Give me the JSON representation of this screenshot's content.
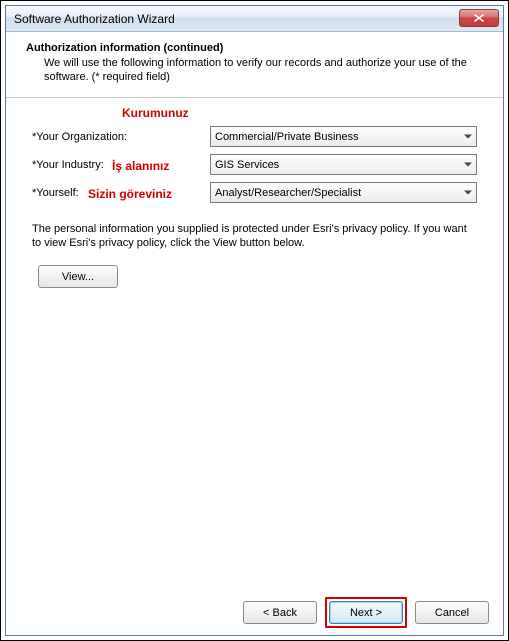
{
  "window": {
    "title": "Software Authorization Wizard"
  },
  "header": {
    "title": "Authorization information (continued)",
    "description": "We will use the following information to verify our records and authorize your use of the software. (* required field)"
  },
  "form": {
    "org_label": "*Your Organization:",
    "org_value": "Commercial/Private Business",
    "industry_label": "*Your Industry:",
    "industry_value": "GIS Services",
    "yourself_label": "*Yourself:",
    "yourself_value": "Analyst/Researcher/Specialist"
  },
  "privacy": {
    "text": "The personal information you supplied is protected under Esri's privacy policy. If you want to view Esri's privacy policy, click the View button below.",
    "view_label": "View..."
  },
  "buttons": {
    "back": "< Back",
    "next": "Next >",
    "cancel": "Cancel"
  },
  "annotations": {
    "org": "Kurumunuz",
    "industry": "İş alanınız",
    "yourself": "Sizin göreviniz"
  }
}
